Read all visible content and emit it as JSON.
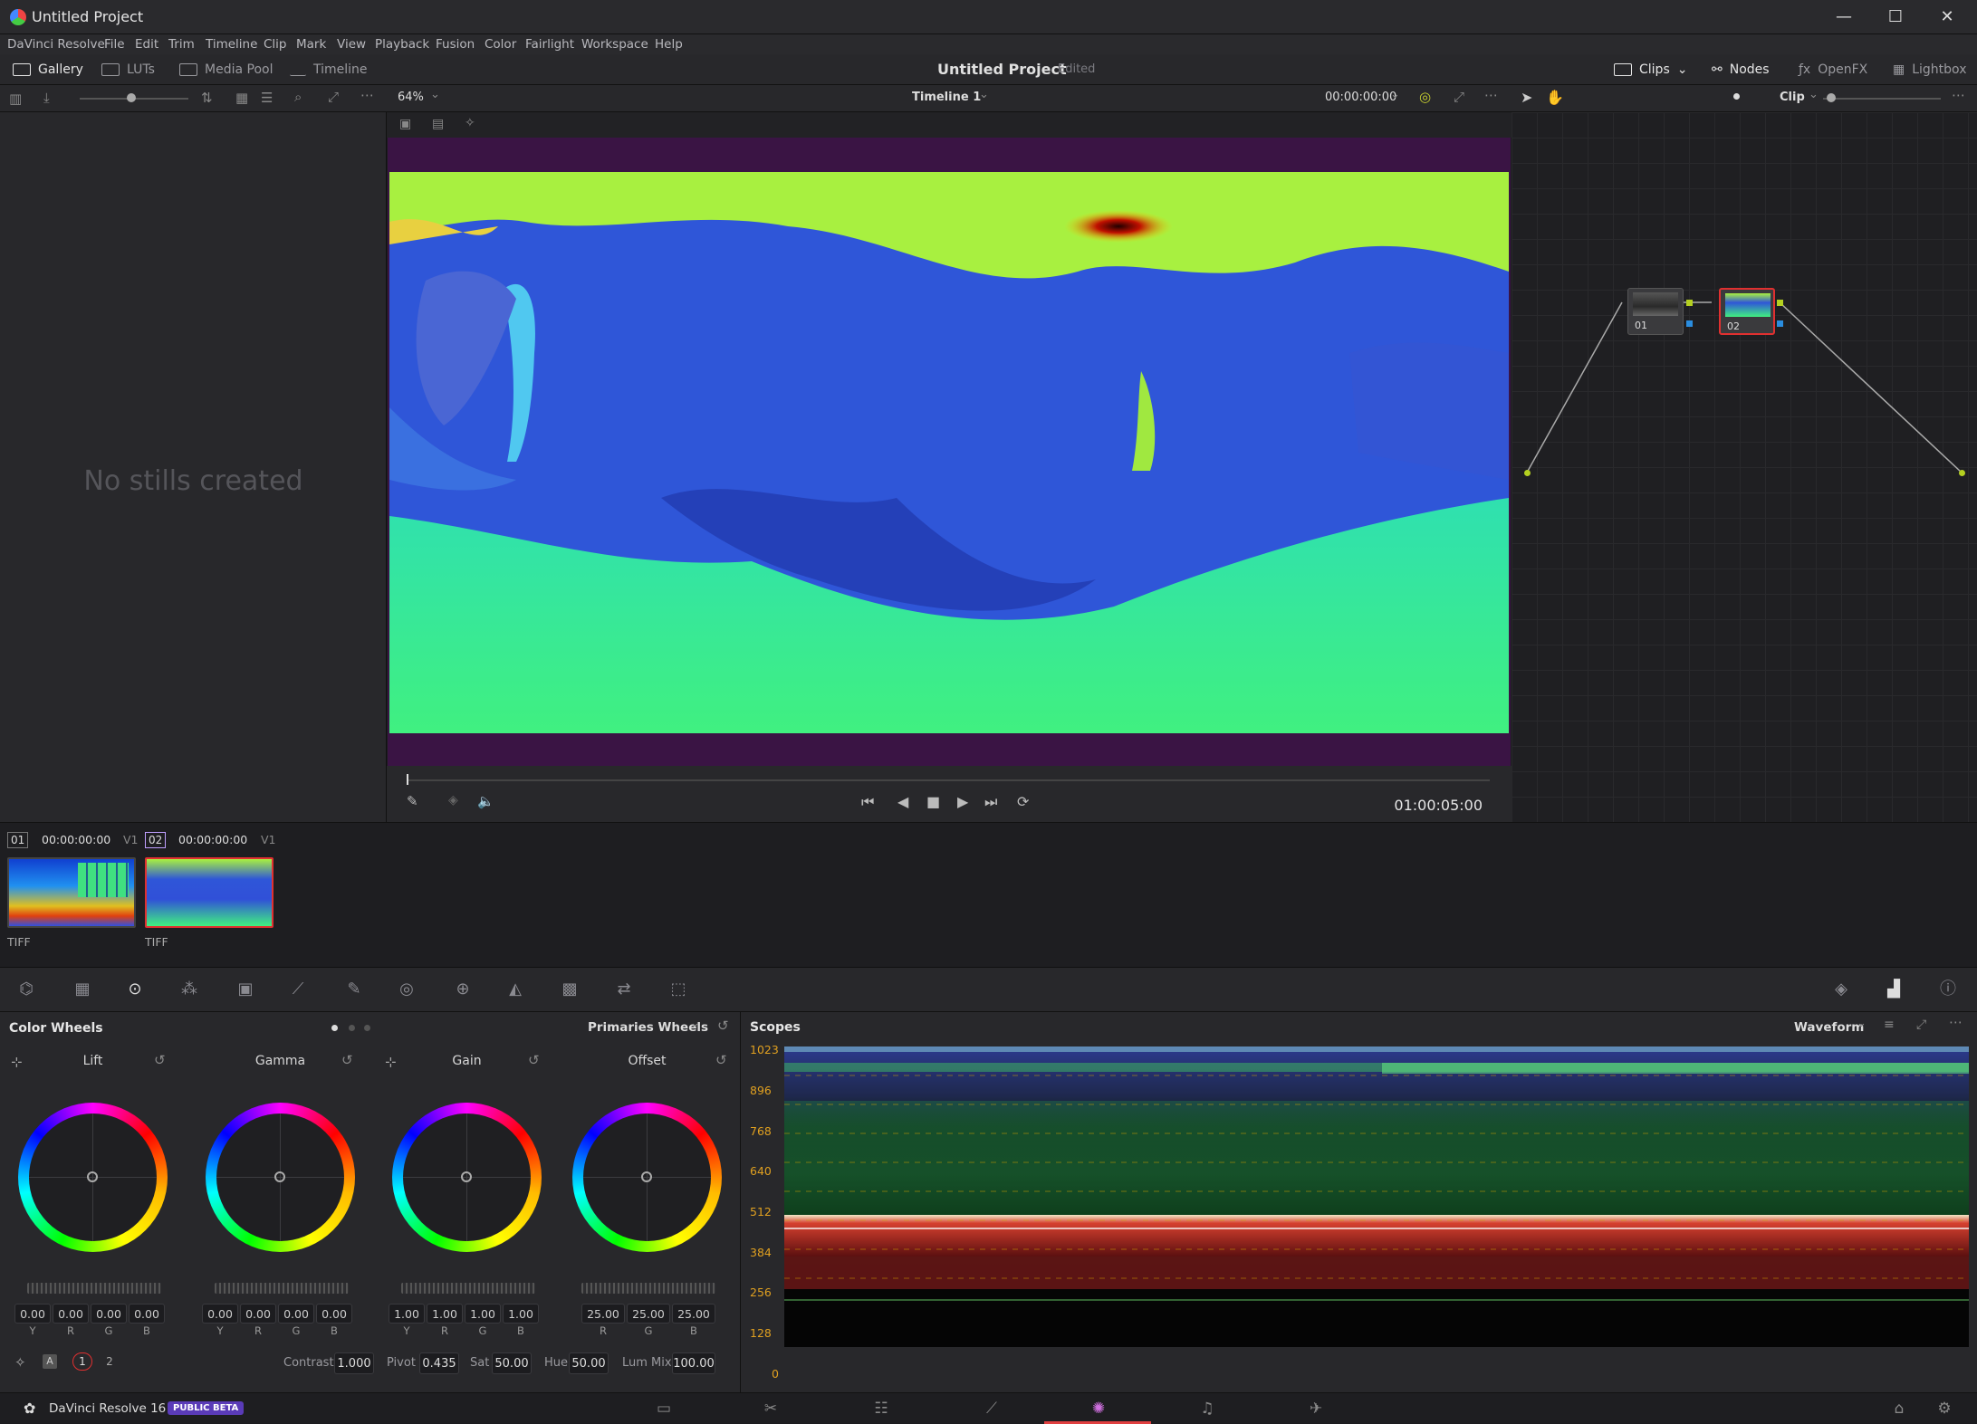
{
  "window": {
    "title": "Untitled Project",
    "minimize": "—",
    "maximize": "☐",
    "close": "✕"
  },
  "menu": [
    "DaVinci Resolve",
    "File",
    "Edit",
    "Trim",
    "Timeline",
    "Clip",
    "Mark",
    "View",
    "Playback",
    "Fusion",
    "Color",
    "Fairlight",
    "Workspace",
    "Help"
  ],
  "toolbar": {
    "gallery": "Gallery",
    "luts": "LUTs",
    "media_pool": "Media Pool",
    "timeline": "Timeline",
    "project": "Untitled Project",
    "status": "Edited",
    "clips": "Clips",
    "nodes": "Nodes",
    "openfx": "OpenFX",
    "lightbox": "Lightbox"
  },
  "gallery": {
    "empty_text": "No stills created"
  },
  "viewer": {
    "zoom": "64%",
    "timeline_name": "Timeline 1",
    "timecode_top": "00:00:00:00",
    "timecode": "01:00:05:00"
  },
  "node_editor": {
    "mode": "Clip",
    "nodes": [
      "01",
      "02"
    ]
  },
  "clips": [
    {
      "num": "01",
      "tc": "00:00:00:00",
      "track": "V1",
      "type": "TIFF"
    },
    {
      "num": "02",
      "tc": "00:00:00:00",
      "track": "V1",
      "type": "TIFF"
    }
  ],
  "color_wheels": {
    "title": "Color Wheels",
    "mode": "Primaries Wheels",
    "wheels": [
      {
        "name": "Lift",
        "values": [
          "0.00",
          "0.00",
          "0.00",
          "0.00"
        ],
        "channels": [
          "Y",
          "R",
          "G",
          "B"
        ]
      },
      {
        "name": "Gamma",
        "values": [
          "0.00",
          "0.00",
          "0.00",
          "0.00"
        ],
        "channels": [
          "Y",
          "R",
          "G",
          "B"
        ]
      },
      {
        "name": "Gain",
        "values": [
          "1.00",
          "1.00",
          "1.00",
          "1.00"
        ],
        "channels": [
          "Y",
          "R",
          "G",
          "B"
        ]
      },
      {
        "name": "Offset",
        "values": [
          "25.00",
          "25.00",
          "25.00"
        ],
        "channels": [
          "R",
          "G",
          "B"
        ]
      }
    ],
    "pages": [
      "1",
      "2"
    ],
    "footer": {
      "contrast_label": "Contrast",
      "contrast": "1.000",
      "pivot_label": "Pivot",
      "pivot": "0.435",
      "sat_label": "Sat",
      "sat": "50.00",
      "hue_label": "Hue",
      "hue": "50.00",
      "lummix_label": "Lum Mix",
      "lummix": "100.00"
    }
  },
  "scopes": {
    "title": "Scopes",
    "type": "Waveform",
    "scale": [
      "1023",
      "896",
      "768",
      "640",
      "512",
      "384",
      "256",
      "128",
      "0"
    ]
  },
  "app": {
    "name": "DaVinci Resolve 16",
    "badge": "PUBLIC BETA"
  }
}
